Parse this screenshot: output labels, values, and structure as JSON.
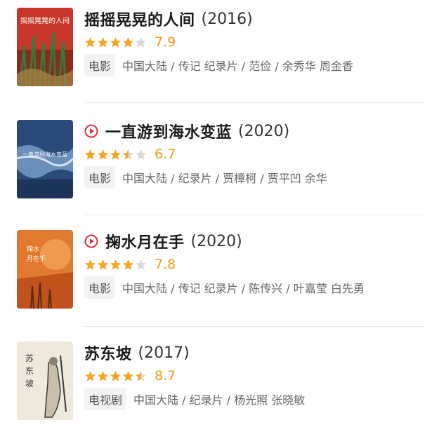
{
  "items": [
    {
      "title": "摇摇晃晃的人间",
      "year": "(2016)",
      "has_play": false,
      "rating_stars": 4,
      "score": "7.9",
      "category": "电影",
      "meta": "中国大陆 / 传记 纪录片 / 范俭 / 余秀华 周金香",
      "poster": {
        "colors": [
          "#c8352a",
          "#8c2a1e",
          "#2f7d3c",
          "#a88844"
        ]
      }
    },
    {
      "title": "一直游到海水变蓝",
      "year": "(2020)",
      "has_play": true,
      "rating_stars": 3.5,
      "score": "6.7",
      "category": "电影",
      "meta": "中国大陆 / 纪录片 / 贾樟柯 / 贾平凹 余华",
      "poster": {
        "colors": [
          "#2b4a7a",
          "#6a8fb8",
          "#d8e2ee",
          "#1c3558"
        ]
      }
    },
    {
      "title": "掬水月在手",
      "year": "(2020)",
      "has_play": true,
      "rating_stars": 4,
      "score": "7.8",
      "category": "电影",
      "meta": "中国大陆 / 传记 纪录片 / 陈传兴 / 叶嘉莹 白先勇",
      "poster": {
        "colors": [
          "#e07a2e",
          "#c2521c",
          "#f2a35a",
          "#5a2a10"
        ]
      }
    },
    {
      "title": "苏东坡",
      "year": "(2017)",
      "has_play": false,
      "rating_stars": 4.5,
      "score": "8.7",
      "category": "电视剧",
      "meta": "中国大陆 / 纪录片 / 杨光照 张晓敏",
      "poster": {
        "colors": [
          "#efe9dc",
          "#3a3a3a",
          "#8a8070",
          "#c9bfa8"
        ]
      }
    }
  ],
  "colors": {
    "star": "#f5a623",
    "star_empty": "#d9d9d9",
    "play": "#e0303a",
    "score": "#ee9b18"
  },
  "icons": {
    "play": "play-circle-icon",
    "star": "star-icon"
  }
}
